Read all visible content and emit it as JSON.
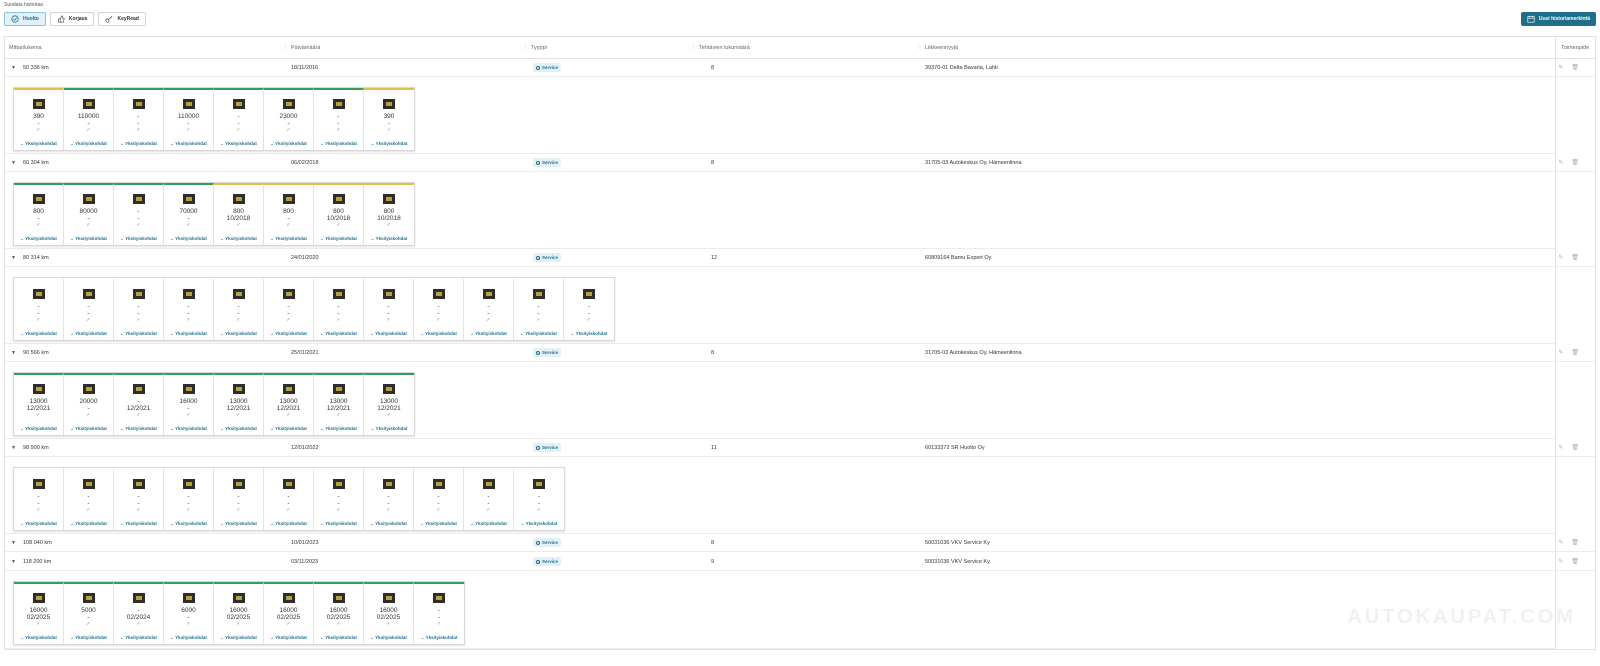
{
  "filter": {
    "label": "Suodata historiaa",
    "buttons": [
      "Huolto",
      "Korjaus",
      "KeyRead"
    ],
    "new_button": "Uusi historiamerkintä"
  },
  "columns": [
    "Mittarilukema",
    "Päivämäärä",
    "Tyyppi",
    "Tehtävien lukumäärä",
    "Liikkeennyyjä",
    "Toimenpide"
  ],
  "type_badge": "Service",
  "card_link": "Yksityiskohdat",
  "rows": [
    {
      "km": "50 336 km",
      "date": "18/11/2016",
      "count": "8",
      "seller": "39370-01 Delta Bavaria, Lahti",
      "cards": [
        [
          "390",
          "-",
          "y"
        ],
        [
          "110000",
          "-",
          "g"
        ],
        [
          "-",
          "-",
          "g"
        ],
        [
          "110000",
          "-",
          "g"
        ],
        [
          "-",
          "-",
          "g"
        ],
        [
          "23000",
          "-",
          "g"
        ],
        [
          "-",
          "-",
          "g"
        ],
        [
          "390",
          "-",
          "y"
        ]
      ]
    },
    {
      "km": "60 304 km",
      "date": "06/02/2018",
      "count": "8",
      "seller": "31705-03 Autokeskus Oy, Hämeenlinna",
      "cards": [
        [
          "800",
          "-",
          "g"
        ],
        [
          "80000",
          "-",
          "g"
        ],
        [
          "-",
          "-",
          "g"
        ],
        [
          "70000",
          "-",
          "g"
        ],
        [
          "800",
          "10/2018",
          "y"
        ],
        [
          "800",
          "-",
          "y"
        ],
        [
          "800",
          "10/2018",
          "y"
        ],
        [
          "800",
          "10/2018",
          "y"
        ]
      ]
    },
    {
      "km": "80 314 km",
      "date": "24/01/2020",
      "count": "12",
      "seller": "60809164 Bamu Expert Oy",
      "cards": [
        [
          "-",
          "-",
          ""
        ],
        [
          "-",
          "-",
          ""
        ],
        [
          "-",
          "-",
          ""
        ],
        [
          "-",
          "-",
          ""
        ],
        [
          "-",
          "-",
          ""
        ],
        [
          "-",
          "-",
          ""
        ],
        [
          "-",
          "-",
          ""
        ],
        [
          "-",
          "-",
          ""
        ],
        [
          "-",
          "-",
          ""
        ],
        [
          "-",
          "-",
          ""
        ],
        [
          "-",
          "-",
          ""
        ],
        [
          "-",
          "-",
          ""
        ]
      ]
    },
    {
      "km": "90 566 km",
      "date": "25/01/2021",
      "count": "8",
      "seller": "31705-03 Autokeskus Oy, Hämeenlinna",
      "cards": [
        [
          "13000",
          "12/2021",
          "g"
        ],
        [
          "20000",
          "-",
          "g"
        ],
        [
          "-",
          "12/2021",
          "g"
        ],
        [
          "16000",
          "-",
          "g"
        ],
        [
          "13000",
          "12/2021",
          "g"
        ],
        [
          "13000",
          "12/2021",
          "g"
        ],
        [
          "13000",
          "12/2021",
          "g"
        ],
        [
          "13000",
          "12/2021",
          "g"
        ]
      ]
    },
    {
      "km": "98 900 km",
      "date": "12/01/2022",
      "count": "11",
      "seller": "60133373 SR Huolto Oy",
      "cards": [
        [
          "-",
          "-",
          ""
        ],
        [
          "-",
          "-",
          ""
        ],
        [
          "-",
          "-",
          ""
        ],
        [
          "-",
          "-",
          ""
        ],
        [
          "-",
          "-",
          ""
        ],
        [
          "-",
          "-",
          ""
        ],
        [
          "-",
          "-",
          ""
        ],
        [
          "-",
          "-",
          ""
        ],
        [
          "-",
          "-",
          ""
        ],
        [
          "-",
          "-",
          ""
        ],
        [
          "-",
          "-",
          ""
        ]
      ]
    },
    {
      "km": "108 040 km",
      "date": "10/01/2023",
      "count": "8",
      "seller": "50031036 VKV Service Ky",
      "cards": []
    },
    {
      "km": "118 200 km",
      "date": "03/11/2023",
      "count": "9",
      "seller": "50031036 VKV Service Ky",
      "cards": [
        [
          "16000",
          "02/2025",
          "g"
        ],
        [
          "5000",
          "-",
          "g"
        ],
        [
          "-",
          "02/2024",
          "g"
        ],
        [
          "6000",
          "-",
          "g"
        ],
        [
          "16000",
          "02/2025",
          "g"
        ],
        [
          "16000",
          "02/2025",
          "g"
        ],
        [
          "16000",
          "02/2025",
          "g"
        ],
        [
          "16000",
          "02/2025",
          "g"
        ],
        [
          "-",
          "-",
          "g"
        ]
      ]
    }
  ],
  "watermark": "AUTOKAUPAT.COM"
}
